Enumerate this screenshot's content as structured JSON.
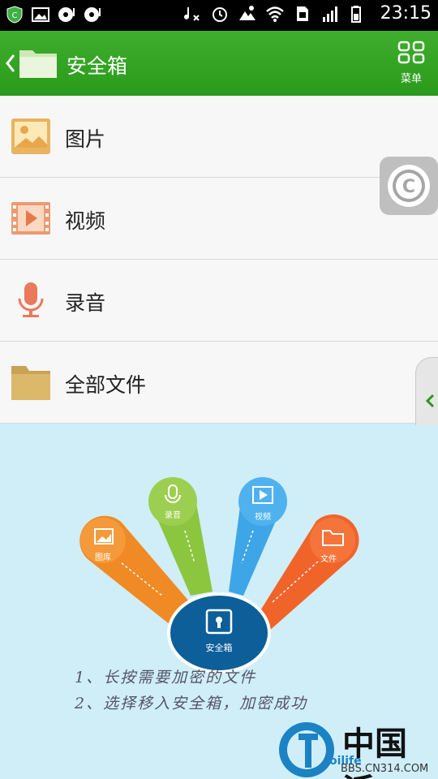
{
  "status_bar": {
    "time": "23:15",
    "left_icons": [
      "shield-app-icon",
      "image-notify-icon",
      "cd-notify-icon",
      "cd-notify-icon"
    ],
    "right_icons": [
      "music-mute-icon",
      "alarm-icon",
      "weather-icon",
      "wifi-icon",
      "sim-icon",
      "signal-icon",
      "battery-icon"
    ]
  },
  "action_bar": {
    "title": "安全箱",
    "menu_label": "菜单",
    "color": "#2f9f22"
  },
  "list": {
    "items": [
      {
        "label": "图片",
        "icon": "picture-icon"
      },
      {
        "label": "视频",
        "icon": "video-icon"
      },
      {
        "label": "录音",
        "icon": "microphone-icon"
      },
      {
        "label": "全部文件",
        "icon": "folder-icon"
      }
    ]
  },
  "guide": {
    "petals": [
      {
        "label": "图库",
        "color": "#f08a24"
      },
      {
        "label": "录音",
        "color": "#8cc63f"
      },
      {
        "label": "视频",
        "color": "#3ea6e6"
      },
      {
        "label": "文件",
        "color": "#f0642a"
      }
    ],
    "center_label": "安全箱",
    "instructions": [
      "1、长按需要加密的文件",
      "2、选择移入安全箱，加密成功"
    ]
  },
  "watermark": {
    "brand": "中国派",
    "url": "BBS.CN314.COM"
  }
}
